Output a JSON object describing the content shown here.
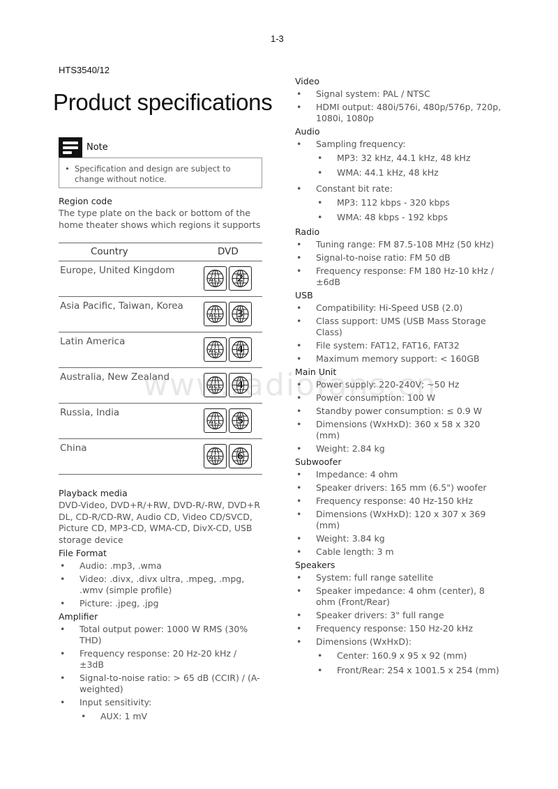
{
  "page_number": "1-3",
  "model": "HTS3540/12",
  "title": "Product specifications",
  "note": {
    "icon": "note-icon",
    "label": "Note",
    "items": [
      "Specification and design are subject to change without notice."
    ]
  },
  "region": {
    "heading": "Region code",
    "description": "The type plate on the back or bottom of the home theater shows which regions it supports",
    "table": {
      "headers": [
        "Country",
        "DVD"
      ],
      "rows": [
        {
          "country": "Europe, United Kingdom",
          "region": "2"
        },
        {
          "country": "Asia Pacific, Taiwan, Korea",
          "region": "3"
        },
        {
          "country": "Latin America",
          "region": "4"
        },
        {
          "country": "Australia, New Zealand",
          "region": "4"
        },
        {
          "country": "Russia, India",
          "region": "5"
        },
        {
          "country": "China",
          "region": "6"
        }
      ],
      "all_label": "ALL"
    }
  },
  "playback": {
    "heading": "Playback media",
    "text": "DVD-Video, DVD+R/+RW, DVD-R/-RW, DVD+R DL, CD-R/CD-RW, Audio CD, Video CD/SVCD, Picture CD, MP3-CD, WMA-CD, DivX-CD, USB storage device"
  },
  "file_format": {
    "heading": "File Format",
    "items": [
      "Audio: .mp3, .wma",
      "Video: .divx, .divx ultra, .mpeg, .mpg, .wmv (simple profile)",
      "Picture: .jpeg, .jpg"
    ]
  },
  "amplifier": {
    "heading": "Amplifier",
    "items": [
      "Total output power: 1000 W RMS (30% THD)",
      "Frequency response: 20 Hz-20 kHz / ±3dB",
      "Signal-to-noise ratio: > 65 dB (CCIR) / (A-weighted)",
      "Input sensitivity:"
    ],
    "sub": [
      "AUX: 1 mV"
    ]
  },
  "video": {
    "heading": "Video",
    "items": [
      "Signal system: PAL / NTSC",
      "HDMI output: 480i/576i, 480p/576p, 720p, 1080i, 1080p"
    ]
  },
  "audio": {
    "heading": "Audio",
    "sampling": "Sampling frequency:",
    "sampling_sub": [
      "MP3: 32 kHz, 44.1 kHz, 48 kHz",
      "WMA: 44.1 kHz, 48 kHz"
    ],
    "bitrate": "Constant bit rate:",
    "bitrate_sub": [
      "MP3: 112 kbps - 320 kbps",
      "WMA: 48 kbps - 192 kbps"
    ]
  },
  "radio": {
    "heading": "Radio",
    "items": [
      "Tuning range: FM 87.5-108 MHz (50 kHz)",
      "Signal-to-noise ratio: FM 50 dB",
      "Frequency response: FM 180 Hz-10 kHz / ±6dB"
    ]
  },
  "usb": {
    "heading": "USB",
    "items": [
      "Compatibility: Hi-Speed USB (2.0)",
      "Class support: UMS (USB Mass Storage Class)",
      "File system: FAT12, FAT16, FAT32",
      "Maximum memory support: < 160GB"
    ]
  },
  "main_unit": {
    "heading": "Main Unit",
    "items": [
      "Power supply: 220-240V; ~50 Hz",
      "Power consumption: 100 W",
      "Standby power consumption: ≤ 0.9 W",
      "Dimensions (WxHxD): 360 x 58 x 320 (mm)",
      "Weight: 2.84 kg"
    ]
  },
  "subwoofer": {
    "heading": "Subwoofer",
    "items": [
      "Impedance: 4 ohm",
      "Speaker drivers: 165 mm (6.5\") woofer",
      "Frequency response: 40 Hz-150 kHz",
      "Dimensions (WxHxD): 120 x 307 x 369 (mm)",
      "Weight: 3.84 kg",
      "Cable length: 3 m"
    ]
  },
  "speakers": {
    "heading": "Speakers",
    "items": [
      "System: full range satellite",
      "Speaker impedance: 4 ohm (center), 8 ohm (Front/Rear)",
      "Speaker drivers: 3\" full range",
      "Frequency response: 150 Hz-20 kHz",
      "Dimensions (WxHxD):"
    ],
    "sub": [
      "Center: 160.9 x 95 x 92 (mm)",
      "Front/Rear: 254 x 1001.5 x 254 (mm)"
    ]
  },
  "watermark": "www.radiofans.cn",
  "bullet": "•"
}
